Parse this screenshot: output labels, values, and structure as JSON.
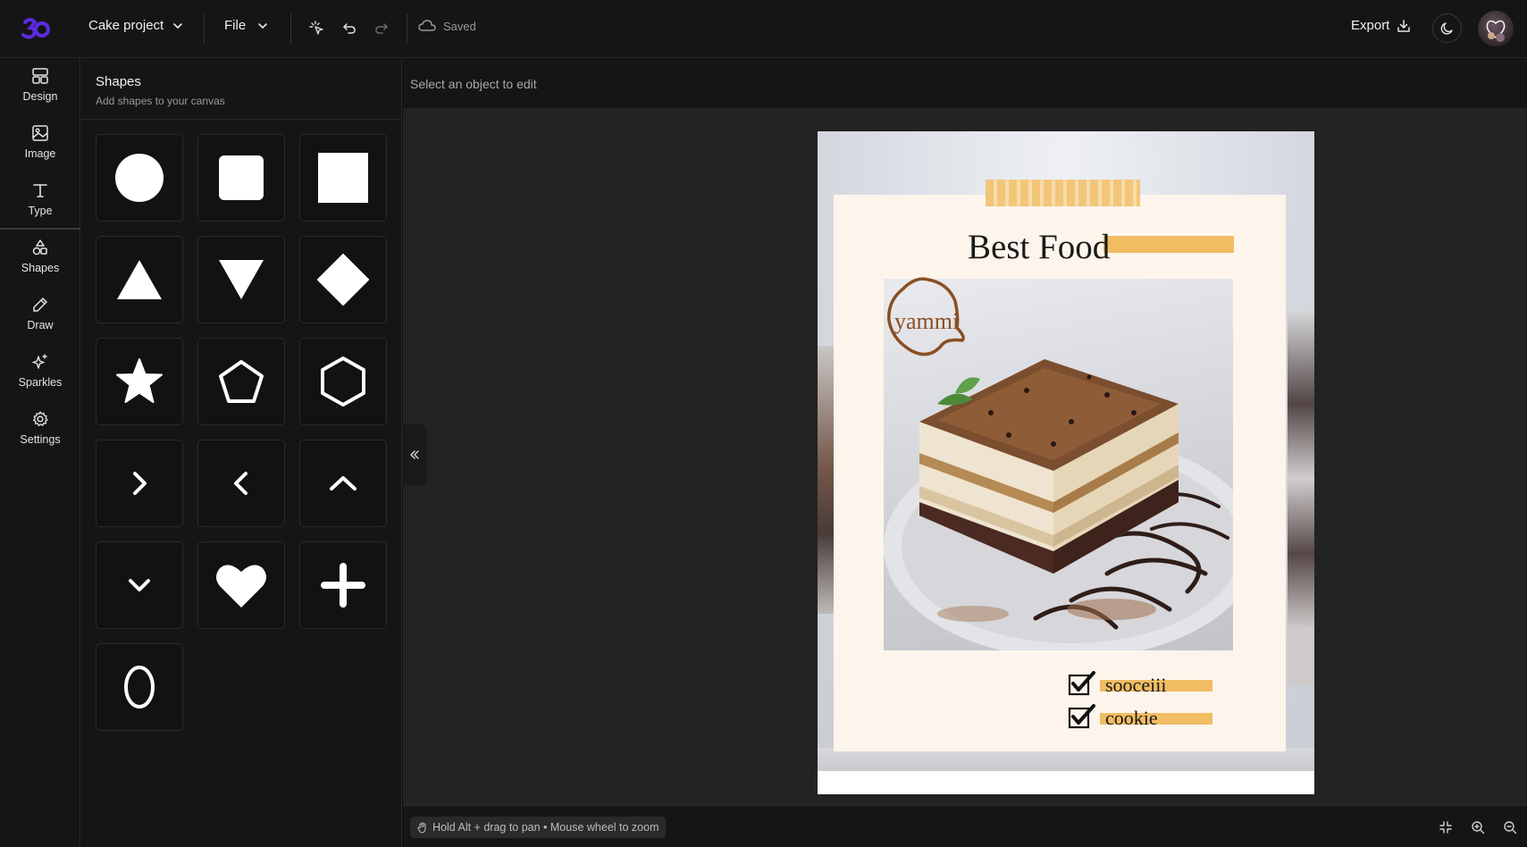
{
  "topbar": {
    "project_name": "Cake project",
    "file_menu": "File",
    "status": "Saved",
    "export_label": "Export"
  },
  "nav": {
    "items": [
      {
        "label": "Design",
        "icon": "layout-icon"
      },
      {
        "label": "Image",
        "icon": "image-icon"
      },
      {
        "label": "Type",
        "icon": "type-icon"
      },
      {
        "label": "Shapes",
        "icon": "shapes-icon"
      },
      {
        "label": "Draw",
        "icon": "pencil-icon"
      },
      {
        "label": "Sparkles",
        "icon": "sparkles-icon"
      },
      {
        "label": "Settings",
        "icon": "gear-icon"
      }
    ]
  },
  "panel": {
    "title": "Shapes",
    "subtitle": "Add shapes to your canvas",
    "shapes": [
      "circle",
      "rounded-square",
      "square",
      "triangle",
      "inverted-triangle",
      "diamond",
      "star",
      "pentagon",
      "hexagon",
      "chevron-right",
      "chevron-left",
      "chevron-up",
      "chevron-down",
      "heart",
      "plus",
      "ellipse-outline"
    ]
  },
  "canvas": {
    "edit_hint": "Select an object to edit",
    "nav_hint": "Hold Alt + drag to pan • Mouse wheel to zoom"
  },
  "design": {
    "title": "Best Food",
    "badge": "yammi",
    "checklist": [
      "sooceiii",
      "cookie"
    ]
  },
  "colors": {
    "accent": "#5b2be0",
    "highlight": "#f0bd63",
    "card": "#fdf5ec",
    "badge": "#8a4f22"
  }
}
